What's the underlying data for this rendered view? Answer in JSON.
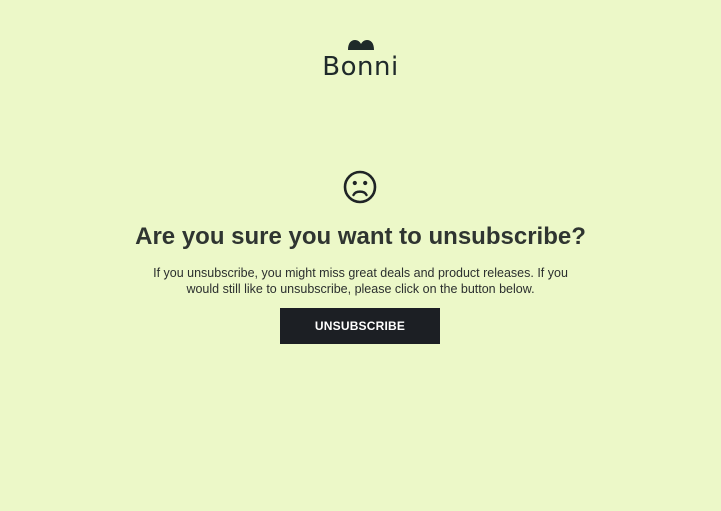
{
  "brand": {
    "name": "Bonni",
    "logo_icon": "heart-mark-icon"
  },
  "icons": {
    "sad_face": "sad-face-icon"
  },
  "content": {
    "headline": "Are you sure you want to unsubscribe?",
    "body": "If you unsubscribe, you might miss great deals and product releases. If you would still like to unsubscribe, please click on the button below.",
    "button_label": "UNSUBSCRIBE"
  },
  "colors": {
    "background": "#ecf8c8",
    "button_bg": "#1c1f24",
    "button_text": "#ffffff",
    "text": "#2b2f2e"
  }
}
